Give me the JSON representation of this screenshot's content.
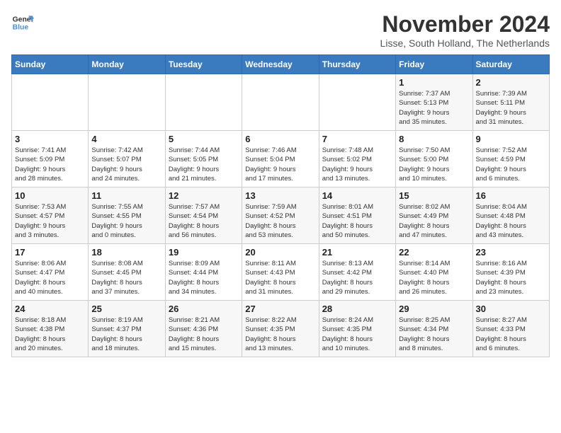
{
  "logo": {
    "line1": "General",
    "line2": "Blue"
  },
  "title": "November 2024",
  "location": "Lisse, South Holland, The Netherlands",
  "days_of_week": [
    "Sunday",
    "Monday",
    "Tuesday",
    "Wednesday",
    "Thursday",
    "Friday",
    "Saturday"
  ],
  "weeks": [
    [
      {
        "day": "",
        "info": ""
      },
      {
        "day": "",
        "info": ""
      },
      {
        "day": "",
        "info": ""
      },
      {
        "day": "",
        "info": ""
      },
      {
        "day": "",
        "info": ""
      },
      {
        "day": "1",
        "info": "Sunrise: 7:37 AM\nSunset: 5:13 PM\nDaylight: 9 hours\nand 35 minutes."
      },
      {
        "day": "2",
        "info": "Sunrise: 7:39 AM\nSunset: 5:11 PM\nDaylight: 9 hours\nand 31 minutes."
      }
    ],
    [
      {
        "day": "3",
        "info": "Sunrise: 7:41 AM\nSunset: 5:09 PM\nDaylight: 9 hours\nand 28 minutes."
      },
      {
        "day": "4",
        "info": "Sunrise: 7:42 AM\nSunset: 5:07 PM\nDaylight: 9 hours\nand 24 minutes."
      },
      {
        "day": "5",
        "info": "Sunrise: 7:44 AM\nSunset: 5:05 PM\nDaylight: 9 hours\nand 21 minutes."
      },
      {
        "day": "6",
        "info": "Sunrise: 7:46 AM\nSunset: 5:04 PM\nDaylight: 9 hours\nand 17 minutes."
      },
      {
        "day": "7",
        "info": "Sunrise: 7:48 AM\nSunset: 5:02 PM\nDaylight: 9 hours\nand 13 minutes."
      },
      {
        "day": "8",
        "info": "Sunrise: 7:50 AM\nSunset: 5:00 PM\nDaylight: 9 hours\nand 10 minutes."
      },
      {
        "day": "9",
        "info": "Sunrise: 7:52 AM\nSunset: 4:59 PM\nDaylight: 9 hours\nand 6 minutes."
      }
    ],
    [
      {
        "day": "10",
        "info": "Sunrise: 7:53 AM\nSunset: 4:57 PM\nDaylight: 9 hours\nand 3 minutes."
      },
      {
        "day": "11",
        "info": "Sunrise: 7:55 AM\nSunset: 4:55 PM\nDaylight: 9 hours\nand 0 minutes."
      },
      {
        "day": "12",
        "info": "Sunrise: 7:57 AM\nSunset: 4:54 PM\nDaylight: 8 hours\nand 56 minutes."
      },
      {
        "day": "13",
        "info": "Sunrise: 7:59 AM\nSunset: 4:52 PM\nDaylight: 8 hours\nand 53 minutes."
      },
      {
        "day": "14",
        "info": "Sunrise: 8:01 AM\nSunset: 4:51 PM\nDaylight: 8 hours\nand 50 minutes."
      },
      {
        "day": "15",
        "info": "Sunrise: 8:02 AM\nSunset: 4:49 PM\nDaylight: 8 hours\nand 47 minutes."
      },
      {
        "day": "16",
        "info": "Sunrise: 8:04 AM\nSunset: 4:48 PM\nDaylight: 8 hours\nand 43 minutes."
      }
    ],
    [
      {
        "day": "17",
        "info": "Sunrise: 8:06 AM\nSunset: 4:47 PM\nDaylight: 8 hours\nand 40 minutes."
      },
      {
        "day": "18",
        "info": "Sunrise: 8:08 AM\nSunset: 4:45 PM\nDaylight: 8 hours\nand 37 minutes."
      },
      {
        "day": "19",
        "info": "Sunrise: 8:09 AM\nSunset: 4:44 PM\nDaylight: 8 hours\nand 34 minutes."
      },
      {
        "day": "20",
        "info": "Sunrise: 8:11 AM\nSunset: 4:43 PM\nDaylight: 8 hours\nand 31 minutes."
      },
      {
        "day": "21",
        "info": "Sunrise: 8:13 AM\nSunset: 4:42 PM\nDaylight: 8 hours\nand 29 minutes."
      },
      {
        "day": "22",
        "info": "Sunrise: 8:14 AM\nSunset: 4:40 PM\nDaylight: 8 hours\nand 26 minutes."
      },
      {
        "day": "23",
        "info": "Sunrise: 8:16 AM\nSunset: 4:39 PM\nDaylight: 8 hours\nand 23 minutes."
      }
    ],
    [
      {
        "day": "24",
        "info": "Sunrise: 8:18 AM\nSunset: 4:38 PM\nDaylight: 8 hours\nand 20 minutes."
      },
      {
        "day": "25",
        "info": "Sunrise: 8:19 AM\nSunset: 4:37 PM\nDaylight: 8 hours\nand 18 minutes."
      },
      {
        "day": "26",
        "info": "Sunrise: 8:21 AM\nSunset: 4:36 PM\nDaylight: 8 hours\nand 15 minutes."
      },
      {
        "day": "27",
        "info": "Sunrise: 8:22 AM\nSunset: 4:35 PM\nDaylight: 8 hours\nand 13 minutes."
      },
      {
        "day": "28",
        "info": "Sunrise: 8:24 AM\nSunset: 4:35 PM\nDaylight: 8 hours\nand 10 minutes."
      },
      {
        "day": "29",
        "info": "Sunrise: 8:25 AM\nSunset: 4:34 PM\nDaylight: 8 hours\nand 8 minutes."
      },
      {
        "day": "30",
        "info": "Sunrise: 8:27 AM\nSunset: 4:33 PM\nDaylight: 8 hours\nand 6 minutes."
      }
    ]
  ]
}
